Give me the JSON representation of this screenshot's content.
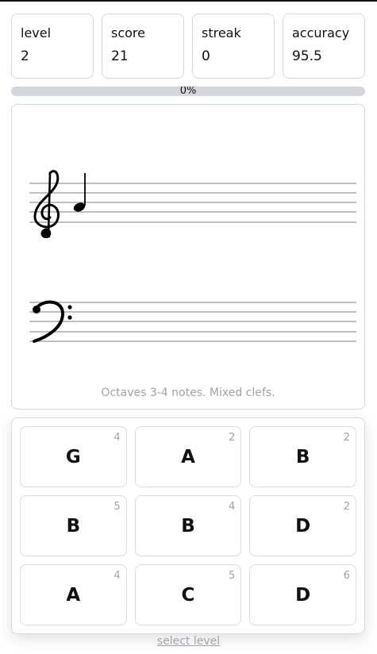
{
  "stats": [
    {
      "label": "level",
      "value": "2"
    },
    {
      "label": "score",
      "value": "21"
    },
    {
      "label": "streak",
      "value": "0"
    },
    {
      "label": "accuracy",
      "value": "95.5"
    }
  ],
  "progress": {
    "percent": 0,
    "text": "0%"
  },
  "staff": {
    "current_note": {
      "clef": "treble",
      "duration": "quarter"
    },
    "hint": "Octaves 3-4 notes. Mixed clefs."
  },
  "answers": [
    {
      "note": "G",
      "count": "4"
    },
    {
      "note": "A",
      "count": "2"
    },
    {
      "note": "B",
      "count": "2"
    },
    {
      "note": "B",
      "count": "5"
    },
    {
      "note": "B",
      "count": "4"
    },
    {
      "note": "D",
      "count": "2"
    },
    {
      "note": "A",
      "count": "4"
    },
    {
      "note": "C",
      "count": "5"
    },
    {
      "note": "D",
      "count": "6"
    }
  ],
  "footer": {
    "select_level": "select level"
  },
  "colors": {
    "border": "#d8d8d8",
    "muted": "#9ca3af",
    "progress_track": "#d3d6dc"
  },
  "icons": [
    "treble-clef-icon",
    "bass-clef-icon",
    "quarter-note-icon"
  ]
}
